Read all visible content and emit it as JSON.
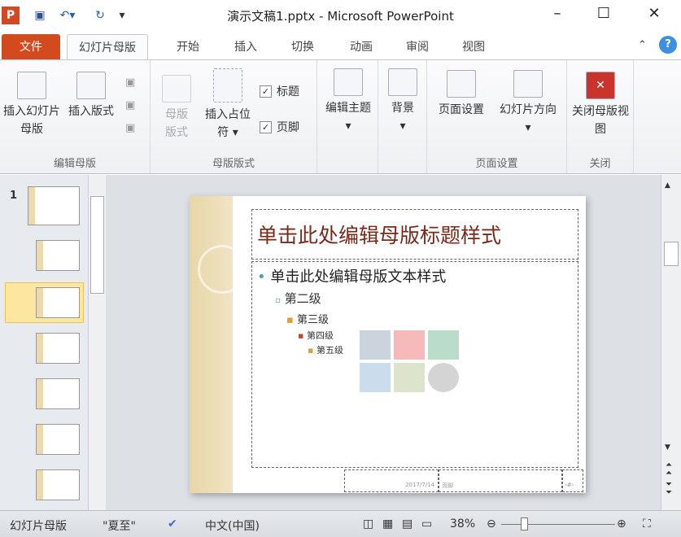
{
  "title": "演示文稿1.pptx - Microsoft PowerPoint",
  "window": {
    "minimize": "–",
    "maximize": "☐",
    "close": "✕"
  },
  "tabs": [
    "文件",
    "幻灯片母版",
    "开始",
    "插入",
    "切换",
    "动画",
    "审阅",
    "视图"
  ],
  "ribbon": {
    "groups": [
      {
        "label": "编辑母版",
        "buttons": [
          "插入幻灯片母版",
          "插入版式"
        ]
      },
      {
        "label": "母版版式",
        "buttons": [
          "母版版式",
          "插入占位符"
        ],
        "checks": [
          "标题",
          "页脚"
        ]
      },
      {
        "buttons": [
          "编辑主题"
        ]
      },
      {
        "buttons": [
          "背景"
        ]
      },
      {
        "label": "页面设置",
        "buttons": [
          "页面设置",
          "幻灯片方向"
        ]
      },
      {
        "label": "关闭",
        "buttons": [
          "关闭母版视图"
        ]
      }
    ]
  },
  "slide": {
    "number": "1",
    "title": "单击此处编辑母版标题样式",
    "levels": [
      "单击此处编辑母版文本样式",
      "第二级",
      "第三级",
      "第四级",
      "第五级"
    ],
    "date": "2017/7/14",
    "footer": "页脚",
    "page": "‹#›"
  },
  "status": {
    "view": "幻灯片母版",
    "theme": "\"夏至\"",
    "language": "中文(中国)",
    "zoom": "38%"
  },
  "colors": {
    "file_tab": "#d34a1f",
    "title_text": "#7a2a1a",
    "band": "#e8d6a8"
  }
}
